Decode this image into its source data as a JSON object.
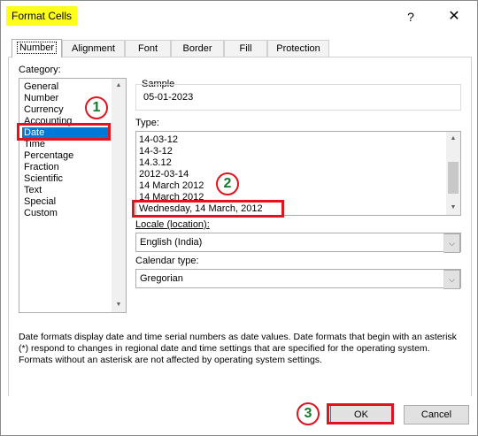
{
  "window": {
    "title": "Format Cells",
    "help_glyph": "?",
    "close_glyph": "✕"
  },
  "tabs": [
    "Number",
    "Alignment",
    "Font",
    "Border",
    "Fill",
    "Protection"
  ],
  "number_tab": {
    "category_label": "Category:",
    "categories": [
      "General",
      "Number",
      "Currency",
      "Accounting",
      "Date",
      "Time",
      "Percentage",
      "Fraction",
      "Scientific",
      "Text",
      "Special",
      "Custom"
    ],
    "selected_category": "Date",
    "sample_label": "Sample",
    "sample_value": "05-01-2023",
    "type_label": "Type:",
    "types": [
      "14-03-12",
      "14-3-12",
      "14.3.12",
      "2012-03-14",
      "14 March 2012",
      "14 March 2012",
      "Wednesday, 14 March, 2012"
    ],
    "selected_type": "Wednesday, 14 March, 2012",
    "locale_label": "Locale (location):",
    "locale_value": "English (India)",
    "calendar_label": "Calendar type:",
    "calendar_value": "Gregorian",
    "description": "Date formats display date and time serial numbers as date values.  Date formats that begin with an asterisk (*) respond to changes in regional date and time settings that are specified for the operating system. Formats without an asterisk are not affected by operating system settings."
  },
  "buttons": {
    "ok": "OK",
    "cancel": "Cancel"
  },
  "annotations": {
    "step1": "1",
    "step2": "2",
    "step3": "3"
  },
  "colors": {
    "highlight": "#ffff1a",
    "annotation_red": "#e0141e",
    "annotation_green": "#137a2b",
    "selection": "#0078d7"
  },
  "icons": {
    "scroll_up": "▲",
    "scroll_down": "▼",
    "dropdown": "⌵"
  }
}
